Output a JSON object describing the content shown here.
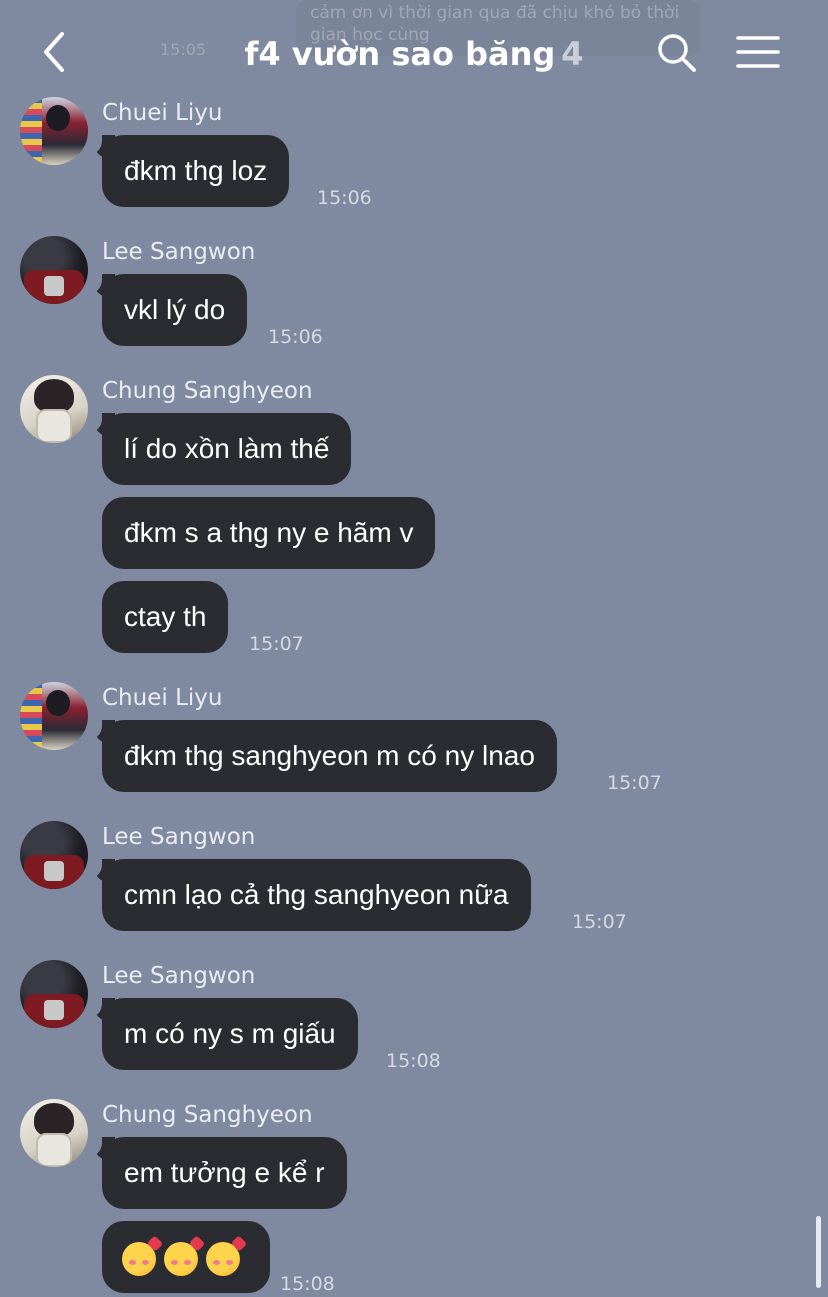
{
  "header": {
    "title": "f4 vườn sao băng",
    "member_count": "4",
    "back_icon": "chevron-left-icon",
    "search_icon": "search-icon",
    "menu_icon": "hamburger-menu-icon",
    "ghost_message": "cảm ơn vì thời gian qua đã chịu khó bỏ thời gian học cùng",
    "ghost_time": "15:05"
  },
  "colors": {
    "background": "#7f899f",
    "bubble": "#2b2c31",
    "bubble_text": "#ffffff",
    "meta_text": "#d5d9e2"
  },
  "messages": [
    {
      "sender": "Chuei Liyu",
      "avatar": "chuei",
      "text": "đkm thg loz",
      "time": "15:06"
    },
    {
      "sender": "Lee Sangwon",
      "avatar": "lee",
      "text": "vkl lý do",
      "time": "15:06"
    },
    {
      "sender": "Chung Sanghyeon",
      "avatar": "chung",
      "texts": [
        "lí do xồn làm thế",
        "đkm s a thg ny e hãm v",
        "ctay th"
      ],
      "time": "15:07"
    },
    {
      "sender": "Chuei Liyu",
      "avatar": "chuei",
      "text": "đkm thg sanghyeon m có ny lnao",
      "time": "15:07"
    },
    {
      "sender": "Lee Sangwon",
      "avatar": "lee",
      "text": "cmn lạo cả thg sanghyeon nữa",
      "time": "15:07"
    },
    {
      "sender": "Lee Sangwon",
      "avatar": "lee",
      "text": "m có ny s m giấu",
      "time": "15:08"
    },
    {
      "sender": "Chung Sanghyeon",
      "avatar": "chung",
      "texts": [
        "em tưởng e kể r",
        "smiling-face-with-hearts x3"
      ],
      "time": "15:08"
    }
  ]
}
